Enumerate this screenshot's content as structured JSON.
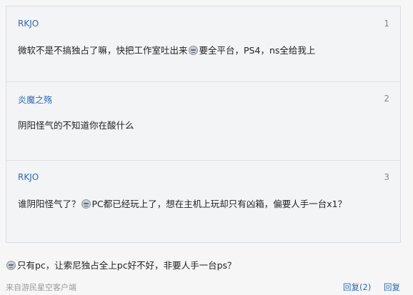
{
  "quoted_replies": [
    {
      "author": "RKJO",
      "floor": "1",
      "text_before": "微软不是不搞独占了嘛，快把工作室吐出来",
      "emoji": "face-icon",
      "text_after": "要全平台，PS4，ns全给我上"
    },
    {
      "author": "炎魔之殇",
      "floor": "2",
      "text_before": "阴阳怪气的不知道你在酸什么",
      "emoji": "",
      "text_after": ""
    },
    {
      "author": "RKJO",
      "floor": "3",
      "text_before": "谁阴阳怪气了？",
      "emoji": "face-icon",
      "text_after": "PC都已经玩上了，想在主机上玩却只有凶箱，偏要人手一台x1？"
    }
  ],
  "post": {
    "emoji": "face-icon",
    "text": "只有pc，让索尼独占全上pc好不好，非要人手一台ps？"
  },
  "footer": {
    "source": "来自游民星空客户端",
    "reply_label": "回复(2)",
    "quote_label": "回复"
  },
  "colors": {
    "link": "#2d68b5",
    "muted": "#999999",
    "quote_bg": "#f3f4f6",
    "page_bg": "#f6f6f6"
  }
}
